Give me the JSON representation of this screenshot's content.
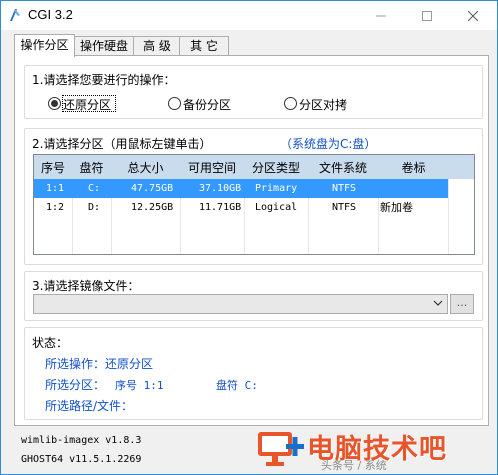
{
  "window": {
    "title": "CGI 3.2"
  },
  "tabs": [
    {
      "label": "操作分区"
    },
    {
      "label": "操作硬盘"
    },
    {
      "label": "高 级"
    },
    {
      "label": "其 它"
    }
  ],
  "operation": {
    "heading": "1.请选择您要进行的操作：",
    "options": [
      {
        "label": "还原分区",
        "checked": true
      },
      {
        "label": "备份分区",
        "checked": false
      },
      {
        "label": "分区对拷",
        "checked": false
      }
    ]
  },
  "partition": {
    "heading": "2.请选择分区（用鼠标左键单击）",
    "system_disk_note": "（系统盘为C:盘）",
    "columns": [
      "序号",
      "盘符",
      "总大小",
      "可用空间",
      "分区类型",
      "文件系统",
      "卷标"
    ],
    "rows": [
      {
        "index": "1:1",
        "drive": "C:",
        "total": "47.75GB",
        "free": "37.10GB",
        "type": "Primary",
        "fs": "NTFS",
        "label": ""
      },
      {
        "index": "1:2",
        "drive": "D:",
        "total": "12.25GB",
        "free": "11.71GB",
        "type": "Logical",
        "fs": "NTFS",
        "label": "新加卷"
      }
    ],
    "selected_row": 0
  },
  "image_file": {
    "heading": "3.请选择镜像文件：",
    "value": "",
    "browse_label": "..."
  },
  "status": {
    "heading": "状态：",
    "operation_label": "所选操作：",
    "operation_value": "还原分区",
    "partition_label": "所选分区：",
    "partition_index": "序号 1:1",
    "partition_drive": "盘符 C:",
    "path_label": "所选路径/文件："
  },
  "versions": {
    "wimlib": "wimlib-imagex v1.8.3",
    "ghost": "GHOST64 v11.5.1.2269"
  },
  "watermark": {
    "brand": "电脑技术吧",
    "footer": "头条号 / 系统"
  },
  "colors": {
    "accent": "#1050c8",
    "selection": "#3399ff",
    "header": "#c9dced",
    "watermark": "#e8552a"
  }
}
